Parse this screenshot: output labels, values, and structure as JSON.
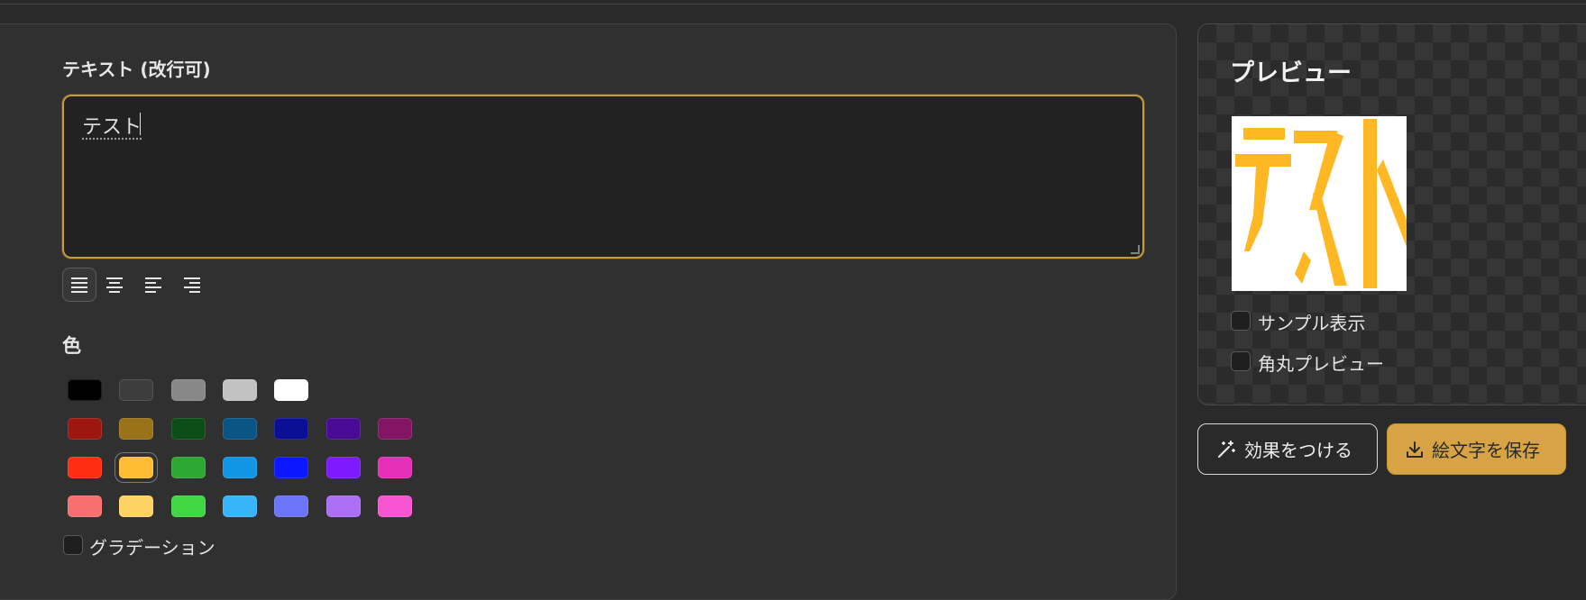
{
  "editor": {
    "text_label": "テキスト (改行可)",
    "text_value": "テスト",
    "alignment": {
      "options": [
        "justify",
        "center",
        "left",
        "right"
      ],
      "selected": "justify"
    },
    "color_label": "色",
    "colors": [
      [
        "#000000",
        "#3d3d3d",
        "#888888",
        "#c2c2c2",
        "#ffffff"
      ],
      [
        "#9b170f",
        "#9a7218",
        "#0c4d18",
        "#0a5584",
        "#0a0f96",
        "#4a0b94",
        "#821664"
      ],
      [
        "#ff2d12",
        "#ffbd35",
        "#2ea834",
        "#1196e4",
        "#0c18ff",
        "#7d1aff",
        "#e52fb6"
      ],
      [
        "#f86f6f",
        "#ffd363",
        "#40d644",
        "#38b4fa",
        "#6c74f7",
        "#ab6ff5",
        "#f855d2"
      ]
    ],
    "selected_color": "#ffbd35",
    "gradient_label": "グラデーション",
    "gradient_checked": false
  },
  "preview": {
    "title": "プレビュー",
    "emoji_text": "テスト",
    "text_color": "#ffb824",
    "background": "#ffffff",
    "sample_label": "サンプル表示",
    "sample_checked": false,
    "rounded_label": "角丸プレビュー",
    "rounded_checked": false
  },
  "actions": {
    "effect_label": "効果をつける",
    "save_label": "絵文字を保存"
  },
  "colors": {
    "accent": "#d7a344",
    "background": "#2a2a2a",
    "panel": "#303030"
  }
}
